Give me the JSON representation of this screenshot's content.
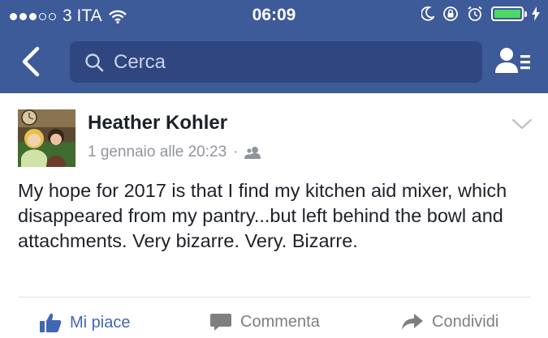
{
  "status_bar": {
    "carrier": "3 ITA",
    "time": "06:09",
    "signal_full": 3,
    "signal_total": 5,
    "battery_level": 1.0,
    "battery_color": "#4cd964"
  },
  "nav": {
    "back_icon": "chevron-left-icon",
    "search_placeholder": "Cerca",
    "friends_icon": "friends-list-icon",
    "background": "#3d5a99"
  },
  "post": {
    "author": "Heather Kohler",
    "timestamp": "1 gennaio alle 20:23",
    "separator": "·",
    "audience_icon": "friends-audience-icon",
    "text": "My hope for 2017 is that I find my kitchen aid mixer, which disappeared from my pantry...but left behind the bowl and attachments.  Very bizarre.  Very. Bizarre."
  },
  "actions": {
    "like": "Mi piace",
    "comment": "Commenta",
    "share": "Condividi",
    "accent": "#4267b2"
  }
}
